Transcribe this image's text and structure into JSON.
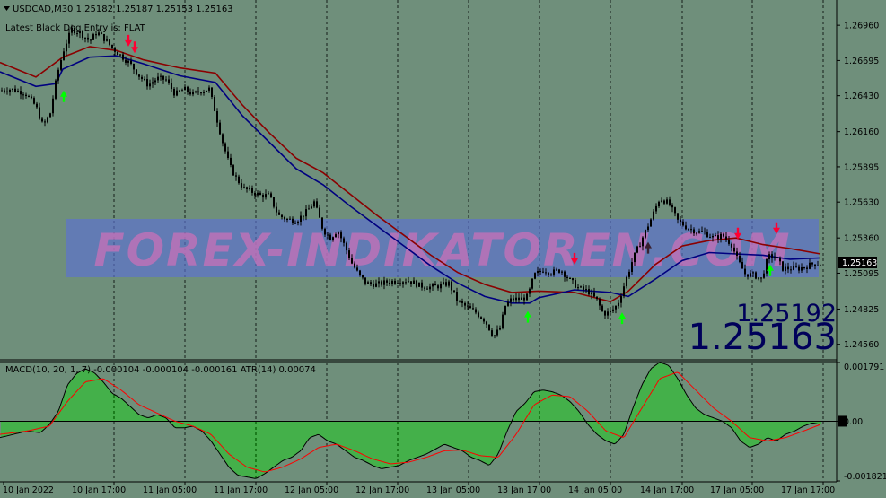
{
  "header": {
    "symbol_line": "USDCAD,M30  1.25182 1.25187 1.25153 1.25163",
    "status_line": "Latest Black Dog Entry is:  FLAT"
  },
  "watermark": "FOREX-INDIKATOREN.COM",
  "price": {
    "bid_small": "1.25192",
    "bid_large": "1.25163",
    "current_tag": "1.25163"
  },
  "macd_label": "MACD(10, 20, 1, 7) -0.000104 -0.000104 -0.000161  ATR(14) 0.00074",
  "colors": {
    "background": "#6f8f7b",
    "candle": "#000000",
    "outer_band": "#8b0000",
    "inner_band": "#000080",
    "buy_arrow": "#00ff00",
    "sell_arrow": "#ff0033",
    "macd_histogram": "#22cc22",
    "macd_signal": "#ff0000",
    "macd_line": "#000000",
    "watermark_band": "#5a6fd6",
    "watermark_text": "#d070b8",
    "big_price": "#00005a"
  },
  "chart_data": [
    {
      "type": "candlestick",
      "symbol": "USDCAD",
      "timeframe": "M30",
      "ylim": [
        1.2445,
        1.2715
      ],
      "y_ticks": [
        "1.26960",
        "1.26695",
        "1.26430",
        "1.26160",
        "1.25895",
        "1.25630",
        "1.25360",
        "1.25095",
        "1.24825",
        "1.24560"
      ],
      "x_ticks": [
        "10 Jan 2022",
        "10 Jan 17:00",
        "11 Jan 05:00",
        "11 Jan 17:00",
        "12 Jan 05:00",
        "12 Jan 17:00",
        "13 Jan 05:00",
        "13 Jan 17:00",
        "14 Jan 05:00",
        "14 Jan 17:00",
        "17 Jan 05:00",
        "17 Jan 17:00"
      ],
      "close_path": [
        [
          0,
          1.2647
        ],
        [
          12,
          1.2648
        ],
        [
          28,
          1.2645
        ],
        [
          40,
          1.2635
        ],
        [
          48,
          1.262
        ],
        [
          56,
          1.263
        ],
        [
          64,
          1.266
        ],
        [
          72,
          1.268
        ],
        [
          80,
          1.2693
        ],
        [
          90,
          1.269
        ],
        [
          100,
          1.2684
        ],
        [
          108,
          1.2691
        ],
        [
          116,
          1.2686
        ],
        [
          125,
          1.2679
        ],
        [
          135,
          1.2673
        ],
        [
          145,
          1.2667
        ],
        [
          155,
          1.2658
        ],
        [
          165,
          1.2651
        ],
        [
          175,
          1.2656
        ],
        [
          185,
          1.2655
        ],
        [
          195,
          1.2644
        ],
        [
          205,
          1.2648
        ],
        [
          215,
          1.2644
        ],
        [
          225,
          1.2647
        ],
        [
          233,
          1.2648
        ],
        [
          240,
          1.263
        ],
        [
          248,
          1.2608
        ],
        [
          256,
          1.259
        ],
        [
          264,
          1.258
        ],
        [
          272,
          1.2573
        ],
        [
          280,
          1.2571
        ],
        [
          290,
          1.2568
        ],
        [
          300,
          1.2568
        ],
        [
          310,
          1.2553
        ],
        [
          320,
          1.255
        ],
        [
          330,
          1.2549
        ],
        [
          342,
          1.2556
        ],
        [
          350,
          1.2563
        ],
        [
          360,
          1.2542
        ],
        [
          368,
          1.2536
        ],
        [
          376,
          1.2542
        ],
        [
          384,
          1.253
        ],
        [
          392,
          1.2517
        ],
        [
          400,
          1.2508
        ],
        [
          408,
          1.2502
        ],
        [
          420,
          1.2501
        ],
        [
          432,
          1.2503
        ],
        [
          444,
          1.2504
        ],
        [
          456,
          1.2504
        ],
        [
          468,
          1.25
        ],
        [
          480,
          1.2499
        ],
        [
          490,
          1.25
        ],
        [
          500,
          1.2502
        ],
        [
          510,
          1.2488
        ],
        [
          520,
          1.2484
        ],
        [
          530,
          1.248
        ],
        [
          540,
          1.2474
        ],
        [
          550,
          1.2462
        ],
        [
          557,
          1.2468
        ],
        [
          563,
          1.2485
        ],
        [
          570,
          1.249
        ],
        [
          580,
          1.249
        ],
        [
          588,
          1.2492
        ],
        [
          595,
          1.2508
        ],
        [
          605,
          1.2512
        ],
        [
          615,
          1.251
        ],
        [
          625,
          1.2512
        ],
        [
          635,
          1.2504
        ],
        [
          645,
          1.2498
        ],
        [
          655,
          1.2496
        ],
        [
          665,
          1.2489
        ],
        [
          672,
          1.2479
        ],
        [
          680,
          1.248
        ],
        [
          688,
          1.2486
        ],
        [
          695,
          1.25
        ],
        [
          705,
          1.252
        ],
        [
          715,
          1.2535
        ],
        [
          725,
          1.255
        ],
        [
          735,
          1.2566
        ],
        [
          745,
          1.2562
        ],
        [
          755,
          1.2549
        ],
        [
          765,
          1.2544
        ],
        [
          775,
          1.2541
        ],
        [
          785,
          1.254
        ],
        [
          795,
          1.2536
        ],
        [
          805,
          1.2538
        ],
        [
          815,
          1.2531
        ],
        [
          822,
          1.2519
        ],
        [
          830,
          1.2509
        ],
        [
          840,
          1.2508
        ],
        [
          848,
          1.2505
        ],
        [
          856,
          1.2522
        ],
        [
          864,
          1.2522
        ],
        [
          872,
          1.2513
        ],
        [
          880,
          1.2513
        ],
        [
          890,
          1.2513
        ],
        [
          900,
          1.2515
        ],
        [
          908,
          1.2517
        ],
        [
          914,
          1.2516
        ]
      ],
      "outer_band": [
        [
          0,
          1.2668
        ],
        [
          40,
          1.2657
        ],
        [
          70,
          1.2672
        ],
        [
          100,
          1.268
        ],
        [
          130,
          1.2677
        ],
        [
          160,
          1.267
        ],
        [
          200,
          1.2664
        ],
        [
          240,
          1.266
        ],
        [
          270,
          1.2636
        ],
        [
          300,
          1.2615
        ],
        [
          330,
          1.2596
        ],
        [
          360,
          1.2585
        ],
        [
          390,
          1.2569
        ],
        [
          420,
          1.2553
        ],
        [
          450,
          1.2538
        ],
        [
          480,
          1.2523
        ],
        [
          510,
          1.251
        ],
        [
          540,
          1.2501
        ],
        [
          570,
          1.2495
        ],
        [
          600,
          1.2496
        ],
        [
          640,
          1.2495
        ],
        [
          680,
          1.2488
        ],
        [
          700,
          1.2496
        ],
        [
          730,
          1.2516
        ],
        [
          760,
          1.253
        ],
        [
          790,
          1.2534
        ],
        [
          820,
          1.2536
        ],
        [
          850,
          1.2531
        ],
        [
          880,
          1.2528
        ],
        [
          914,
          1.2524
        ]
      ],
      "inner_band": [
        [
          0,
          1.2661
        ],
        [
          40,
          1.265
        ],
        [
          62,
          1.2652
        ],
        [
          70,
          1.2663
        ],
        [
          100,
          1.2672
        ],
        [
          130,
          1.2673
        ],
        [
          160,
          1.2667
        ],
        [
          200,
          1.2658
        ],
        [
          240,
          1.2653
        ],
        [
          270,
          1.2628
        ],
        [
          300,
          1.2608
        ],
        [
          330,
          1.2588
        ],
        [
          360,
          1.2576
        ],
        [
          390,
          1.256
        ],
        [
          420,
          1.2545
        ],
        [
          450,
          1.253
        ],
        [
          480,
          1.2515
        ],
        [
          510,
          1.2502
        ],
        [
          540,
          1.2492
        ],
        [
          570,
          1.2487
        ],
        [
          590,
          1.2487
        ],
        [
          600,
          1.2491
        ],
        [
          640,
          1.2497
        ],
        [
          680,
          1.2495
        ],
        [
          700,
          1.2492
        ],
        [
          730,
          1.2505
        ],
        [
          760,
          1.2519
        ],
        [
          790,
          1.2525
        ],
        [
          820,
          1.2524
        ],
        [
          850,
          1.2523
        ],
        [
          880,
          1.252
        ],
        [
          914,
          1.2521
        ]
      ],
      "signals": [
        {
          "type": "buy",
          "x": 71,
          "price": 1.2645
        },
        {
          "type": "sell",
          "x": 143,
          "price": 1.2682
        },
        {
          "type": "sell",
          "x": 150,
          "price": 1.2677
        },
        {
          "type": "buy",
          "x": 588,
          "price": 1.2479
        },
        {
          "type": "sell",
          "x": 640,
          "price": 1.2518
        },
        {
          "type": "buy",
          "x": 693,
          "price": 1.2478
        },
        {
          "type": "exit",
          "x": 722,
          "price": 1.2531
        },
        {
          "type": "sell",
          "x": 822,
          "price": 1.2537
        },
        {
          "type": "buy",
          "x": 858,
          "price": 1.2514
        },
        {
          "type": "sell",
          "x": 865,
          "price": 1.2541
        }
      ]
    },
    {
      "type": "macd",
      "ylim": [
        -0.001821,
        0.001791
      ],
      "y_ticks": [
        "0.001791",
        "0.00",
        "-0.001821"
      ],
      "histogram": [
        [
          0,
          -0.0005
        ],
        [
          15,
          -0.0004
        ],
        [
          30,
          -0.0003
        ],
        [
          45,
          -0.00035
        ],
        [
          55,
          -0.0001
        ],
        [
          65,
          0.0003
        ],
        [
          75,
          0.0011
        ],
        [
          85,
          0.00145
        ],
        [
          95,
          0.0016
        ],
        [
          105,
          0.00148
        ],
        [
          115,
          0.0012
        ],
        [
          125,
          0.00085
        ],
        [
          135,
          0.0007
        ],
        [
          145,
          0.00045
        ],
        [
          155,
          0.0002
        ],
        [
          165,
          0.0001
        ],
        [
          175,
          0.0002
        ],
        [
          185,
          0.0001
        ],
        [
          195,
          -0.0002
        ],
        [
          205,
          -0.0002
        ],
        [
          215,
          -0.00015
        ],
        [
          225,
          -0.0003
        ],
        [
          235,
          -0.0006
        ],
        [
          245,
          -0.001
        ],
        [
          255,
          -0.0014
        ],
        [
          265,
          -0.00165
        ],
        [
          275,
          -0.0017
        ],
        [
          285,
          -0.00175
        ],
        [
          295,
          -0.0016
        ],
        [
          305,
          -0.0014
        ],
        [
          315,
          -0.0012
        ],
        [
          325,
          -0.0011
        ],
        [
          335,
          -0.0009
        ],
        [
          345,
          -0.0005
        ],
        [
          355,
          -0.0004
        ],
        [
          365,
          -0.0006
        ],
        [
          375,
          -0.0007
        ],
        [
          385,
          -0.0009
        ],
        [
          395,
          -0.0011
        ],
        [
          405,
          -0.0012
        ],
        [
          415,
          -0.00135
        ],
        [
          425,
          -0.00145
        ],
        [
          435,
          -0.0014
        ],
        [
          445,
          -0.00135
        ],
        [
          455,
          -0.0012
        ],
        [
          465,
          -0.0011
        ],
        [
          475,
          -0.001
        ],
        [
          485,
          -0.00085
        ],
        [
          495,
          -0.0007
        ],
        [
          505,
          -0.0008
        ],
        [
          515,
          -0.0009
        ],
        [
          525,
          -0.0011
        ],
        [
          535,
          -0.0012
        ],
        [
          545,
          -0.00135
        ],
        [
          555,
          -0.001
        ],
        [
          565,
          -0.0003
        ],
        [
          575,
          0.0003
        ],
        [
          585,
          0.00055
        ],
        [
          595,
          0.0009
        ],
        [
          605,
          0.00095
        ],
        [
          615,
          0.0009
        ],
        [
          625,
          0.0008
        ],
        [
          635,
          0.0006
        ],
        [
          645,
          0.0003
        ],
        [
          655,
          -0.0001
        ],
        [
          665,
          -0.0004
        ],
        [
          675,
          -0.0006
        ],
        [
          685,
          -0.0007
        ],
        [
          695,
          -0.0004
        ],
        [
          705,
          0.0004
        ],
        [
          715,
          0.0011
        ],
        [
          725,
          0.0016
        ],
        [
          735,
          0.0018
        ],
        [
          745,
          0.0017
        ],
        [
          755,
          0.0013
        ],
        [
          765,
          0.0008
        ],
        [
          775,
          0.0004
        ],
        [
          785,
          0.0002
        ],
        [
          795,
          0.0001
        ],
        [
          805,
          0.0
        ],
        [
          815,
          -0.0002
        ],
        [
          825,
          -0.0006
        ],
        [
          835,
          -0.0008
        ],
        [
          845,
          -0.0007
        ],
        [
          855,
          -0.0005
        ],
        [
          865,
          -0.0006
        ],
        [
          875,
          -0.0004
        ],
        [
          885,
          -0.0003
        ],
        [
          895,
          -0.00015
        ],
        [
          905,
          -5e-05
        ],
        [
          914,
          -0.0001
        ]
      ],
      "signal_line": [
        [
          0,
          -0.0004
        ],
        [
          30,
          -0.0003
        ],
        [
          55,
          -0.00015
        ],
        [
          75,
          0.0006
        ],
        [
          95,
          0.0012
        ],
        [
          115,
          0.0013
        ],
        [
          135,
          0.00095
        ],
        [
          155,
          0.0005
        ],
        [
          175,
          0.00025
        ],
        [
          195,
          0.0
        ],
        [
          215,
          -0.00015
        ],
        [
          235,
          -0.0004
        ],
        [
          255,
          -0.001
        ],
        [
          275,
          -0.0014
        ],
        [
          295,
          -0.00155
        ],
        [
          315,
          -0.0014
        ],
        [
          335,
          -0.00115
        ],
        [
          355,
          -0.0008
        ],
        [
          375,
          -0.0007
        ],
        [
          395,
          -0.0009
        ],
        [
          415,
          -0.00115
        ],
        [
          435,
          -0.0013
        ],
        [
          455,
          -0.00125
        ],
        [
          475,
          -0.0011
        ],
        [
          495,
          -0.0009
        ],
        [
          515,
          -0.00088
        ],
        [
          535,
          -0.00105
        ],
        [
          555,
          -0.0011
        ],
        [
          575,
          -0.0004
        ],
        [
          595,
          0.0005
        ],
        [
          615,
          0.0008
        ],
        [
          635,
          0.00075
        ],
        [
          655,
          0.0003
        ],
        [
          675,
          -0.0003
        ],
        [
          695,
          -0.0005
        ],
        [
          715,
          0.0004
        ],
        [
          735,
          0.0013
        ],
        [
          755,
          0.0015
        ],
        [
          775,
          0.00095
        ],
        [
          795,
          0.0004
        ],
        [
          815,
          0.0
        ],
        [
          835,
          -0.0005
        ],
        [
          855,
          -0.0006
        ],
        [
          875,
          -0.0005
        ],
        [
          895,
          -0.0003
        ],
        [
          914,
          -0.0001
        ]
      ]
    }
  ]
}
